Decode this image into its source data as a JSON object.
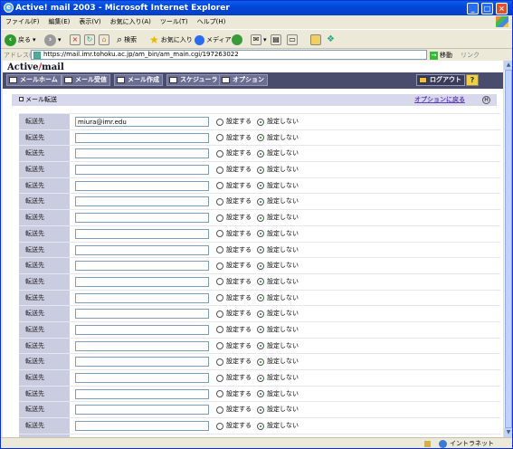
{
  "window": {
    "title": "Active! mail 2003 - Microsoft Internet Explorer"
  },
  "menu": [
    "ファイル(F)",
    "編集(E)",
    "表示(V)",
    "お気に入り(A)",
    "ツール(T)",
    "ヘルプ(H)"
  ],
  "toolbar": {
    "back": "戻る",
    "search": "検索",
    "favorites": "お気に入り",
    "media": "メディア"
  },
  "address": {
    "label": "アドレス(D)",
    "url": "https://mail.imr.tohoku.ac.jp/am_bin/am_main.cgi/197263022",
    "go": "移動",
    "links": "リンク"
  },
  "app": {
    "logo_a": "Active",
    "logo_slash": "/",
    "logo_b": "mail",
    "nav": [
      "メールホーム",
      "メール受信",
      "メール作成",
      "スケジューラ",
      "オプション"
    ],
    "logout": "ログアウト",
    "help": "?"
  },
  "section": {
    "title": "メール転送",
    "back_link": "オプションに戻る",
    "hotkey": "H"
  },
  "forward": {
    "row_label": "転送先",
    "opt_on": "設定する",
    "opt_off": "設定しない",
    "rows": [
      {
        "value": "miura@imr.edu",
        "enabled": false
      },
      {
        "value": "",
        "enabled": false
      },
      {
        "value": "",
        "enabled": false
      },
      {
        "value": "",
        "enabled": false
      },
      {
        "value": "",
        "enabled": false
      },
      {
        "value": "",
        "enabled": false
      },
      {
        "value": "",
        "enabled": false
      },
      {
        "value": "",
        "enabled": false
      },
      {
        "value": "",
        "enabled": false
      },
      {
        "value": "",
        "enabled": false
      },
      {
        "value": "",
        "enabled": false
      },
      {
        "value": "",
        "enabled": false
      },
      {
        "value": "",
        "enabled": false
      },
      {
        "value": "",
        "enabled": false
      },
      {
        "value": "",
        "enabled": false
      },
      {
        "value": "",
        "enabled": false
      },
      {
        "value": "",
        "enabled": false
      },
      {
        "value": "",
        "enabled": false
      },
      {
        "value": "",
        "enabled": false
      },
      {
        "value": "",
        "enabled": false
      },
      {
        "value": "",
        "enabled": false
      },
      {
        "value": "",
        "enabled": false
      }
    ]
  },
  "status": {
    "zone": "イントラネット"
  }
}
